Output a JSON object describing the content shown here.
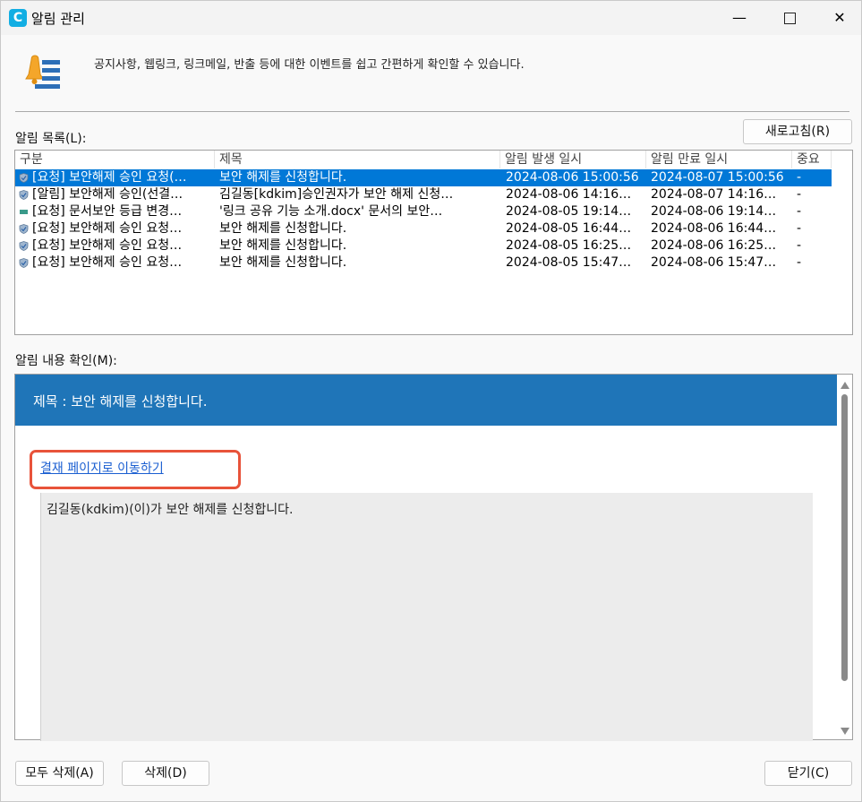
{
  "window": {
    "title": "알림 관리",
    "app_icon_letter": "C"
  },
  "header": {
    "description": "공지사항, 웹링크, 링크메일, 반출 등에 대한 이벤트를 쉽고 간편하게 확인할 수 있습니다."
  },
  "list": {
    "label": "알림 목록(L):",
    "refresh_label": "새로고침(R)",
    "columns": [
      "구분",
      "제목",
      "알림 발생 일시",
      "알림 만료 일시",
      "중요"
    ],
    "rows": [
      {
        "type": "[요청] 보안해제 승인 요청(…",
        "title": "보안 해제를 신청합니다.",
        "start": "2024-08-06 15:00:56",
        "end": "2024-08-07 15:00:56",
        "important": "-",
        "icon": "shield-icon",
        "selected": true
      },
      {
        "type": "[알림] 보안해제 승인(선결…",
        "title": "김길동[kdkim]승인권자가 보안 해제 신청…",
        "start": "2024-08-06 14:16…",
        "end": "2024-08-07 14:16…",
        "important": "-",
        "icon": "shield-icon",
        "selected": false
      },
      {
        "type": "[요청] 문서보안 등급 변경…",
        "title": "'링크 공유 기능 소개.docx' 문서의 보안…",
        "start": "2024-08-05 19:14…",
        "end": "2024-08-06 19:14…",
        "important": "-",
        "icon": "document-icon",
        "selected": false
      },
      {
        "type": "[요청] 보안해제 승인 요청…",
        "title": "보안 해제를 신청합니다.",
        "start": "2024-08-05 16:44…",
        "end": "2024-08-06 16:44…",
        "important": "-",
        "icon": "shield-icon",
        "selected": false
      },
      {
        "type": "[요청] 보안해제 승인 요청…",
        "title": "보안 해제를 신청합니다.",
        "start": "2024-08-05 16:25…",
        "end": "2024-08-06 16:25…",
        "important": "-",
        "icon": "shield-icon",
        "selected": false
      },
      {
        "type": "[요청] 보안해제 승인 요청…",
        "title": "보안 해제를 신청합니다.",
        "start": "2024-08-05 15:47…",
        "end": "2024-08-06 15:47…",
        "important": "-",
        "icon": "shield-icon",
        "selected": false
      }
    ]
  },
  "detail": {
    "label": "알림 내용 확인(M):",
    "title": "제목 : 보안 해제를 신청합니다.",
    "link_text": "결재 페이지로 이동하기",
    "body": "김길동(kdkim)(이)가 보안 해제를 신청합니다."
  },
  "footer": {
    "delete_all_label": "모두 삭제(A)",
    "delete_label": "삭제(D)",
    "close_label": "닫기(C)"
  },
  "colors": {
    "selection": "#0078d7",
    "banner": "#1f75b8",
    "link": "#1b5fd1",
    "highlight": "#e8533a"
  }
}
